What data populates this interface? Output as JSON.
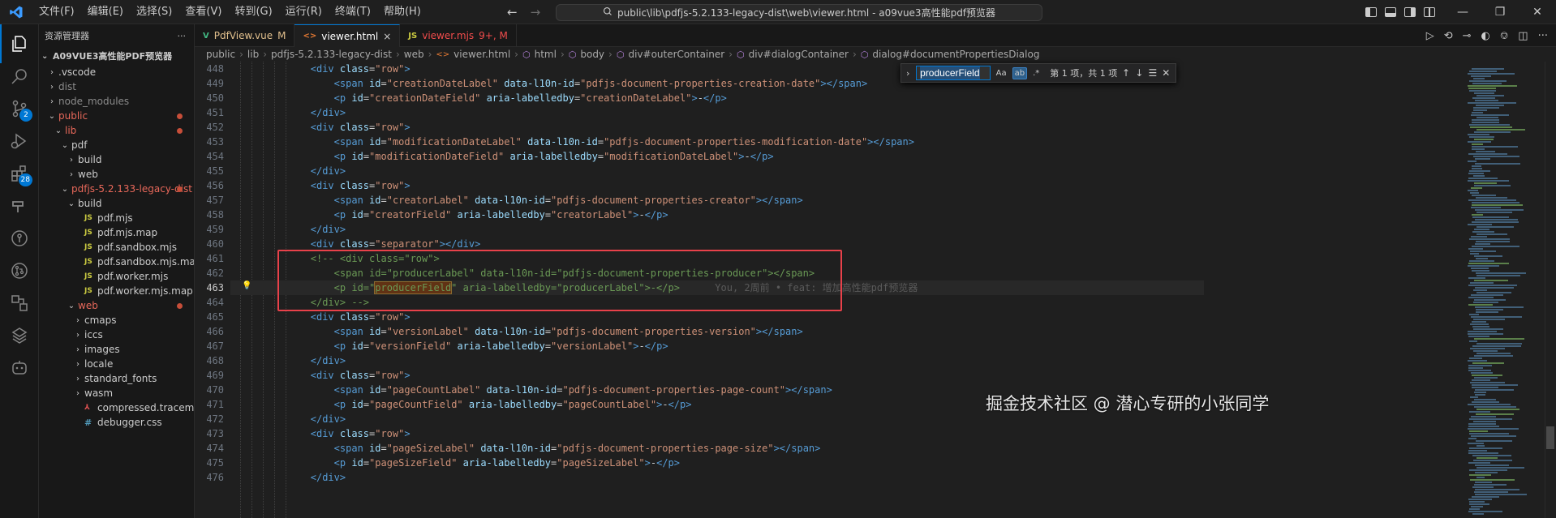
{
  "titlebar": {
    "menu": [
      "文件(F)",
      "编辑(E)",
      "选择(S)",
      "查看(V)",
      "转到(G)",
      "运行(R)",
      "终端(T)",
      "帮助(H)"
    ],
    "command_center": "public\\lib\\pdfjs-5.2.133-legacy-dist\\web\\viewer.html - a09vue3高性能pdf预览器"
  },
  "activity": {
    "scm_badge": "2",
    "extensions_badge": "28"
  },
  "sidebar": {
    "title": "资源管理器",
    "more": "···",
    "root": "A09VUE3高性能PDF预览器",
    "items": [
      {
        "label": ".vscode",
        "depth": 0,
        "kind": "folder-closed",
        "style": "normal"
      },
      {
        "label": "dist",
        "depth": 0,
        "kind": "folder-closed",
        "style": "dim"
      },
      {
        "label": "node_modules",
        "depth": 0,
        "kind": "folder-closed",
        "style": "dim"
      },
      {
        "label": "public",
        "depth": 0,
        "kind": "folder-open",
        "style": "red",
        "dot": true
      },
      {
        "label": "lib",
        "depth": 1,
        "kind": "folder-open",
        "style": "red",
        "dot": true
      },
      {
        "label": "pdf",
        "depth": 2,
        "kind": "folder-open",
        "style": "normal"
      },
      {
        "label": "build",
        "depth": 3,
        "kind": "folder-closed",
        "style": "normal"
      },
      {
        "label": "web",
        "depth": 3,
        "kind": "folder-closed",
        "style": "normal"
      },
      {
        "label": "pdfjs-5.2.133-legacy-dist",
        "depth": 2,
        "kind": "folder-open",
        "style": "red",
        "dot": true
      },
      {
        "label": "build",
        "depth": 3,
        "kind": "folder-open",
        "style": "normal"
      },
      {
        "label": "pdf.mjs",
        "depth": 4,
        "kind": "js",
        "style": "normal"
      },
      {
        "label": "pdf.mjs.map",
        "depth": 4,
        "kind": "js",
        "style": "normal"
      },
      {
        "label": "pdf.sandbox.mjs",
        "depth": 4,
        "kind": "js",
        "style": "normal"
      },
      {
        "label": "pdf.sandbox.mjs.map",
        "depth": 4,
        "kind": "js",
        "style": "normal"
      },
      {
        "label": "pdf.worker.mjs",
        "depth": 4,
        "kind": "js",
        "style": "normal"
      },
      {
        "label": "pdf.worker.mjs.map",
        "depth": 4,
        "kind": "js",
        "style": "normal"
      },
      {
        "label": "web",
        "depth": 3,
        "kind": "folder-open",
        "style": "red",
        "dot": true
      },
      {
        "label": "cmaps",
        "depth": 4,
        "kind": "folder-closed",
        "style": "normal"
      },
      {
        "label": "iccs",
        "depth": 4,
        "kind": "folder-closed",
        "style": "normal"
      },
      {
        "label": "images",
        "depth": 4,
        "kind": "folder-closed",
        "style": "normal"
      },
      {
        "label": "locale",
        "depth": 4,
        "kind": "folder-closed",
        "style": "normal"
      },
      {
        "label": "standard_fonts",
        "depth": 4,
        "kind": "folder-closed",
        "style": "normal"
      },
      {
        "label": "wasm",
        "depth": 4,
        "kind": "folder-closed",
        "style": "normal"
      },
      {
        "label": "compressed.tracemonkey-pld...",
        "depth": 4,
        "kind": "pdf",
        "style": "normal"
      },
      {
        "label": "debugger.css",
        "depth": 4,
        "kind": "css",
        "style": "normal"
      }
    ]
  },
  "tabs": [
    {
      "label": "PdfView.vue",
      "icon": "V",
      "status": "M",
      "active": false,
      "icon_color": "#42b883",
      "status_kind": "mod"
    },
    {
      "label": "viewer.html",
      "icon": "<>",
      "status": "×",
      "active": true,
      "icon_color": "#e37933",
      "status_kind": "close"
    },
    {
      "label": "viewer.mjs",
      "icon": "JS",
      "status": "9+, M",
      "active": false,
      "icon_color": "#cbcb41",
      "status_kind": "err"
    }
  ],
  "breadcrumbs": [
    "public",
    "lib",
    "pdfjs-5.2.133-legacy-dist",
    "web",
    "viewer.html",
    "html",
    "body",
    "div#outerContainer",
    "div#dialogContainer",
    "dialog#documentPropertiesDialog"
  ],
  "find": {
    "query": "producerField",
    "count": "第 1 项，共 1 项",
    "case_label": "Aa",
    "word_label": "ab",
    "regex_label": ".*"
  },
  "editor": {
    "current_line": 463,
    "blame": "You, 2周前 • feat: 增加高性能pdf预览器",
    "lines": [
      {
        "n": 448,
        "indent": 3,
        "tokens": [
          [
            "tag",
            "<div "
          ],
          [
            "attr",
            "class"
          ],
          [
            "txt",
            "="
          ],
          [
            "str",
            "\"row\""
          ],
          [
            "tag",
            ">"
          ]
        ]
      },
      {
        "n": 449,
        "indent": 4,
        "tokens": [
          [
            "tag",
            "<span "
          ],
          [
            "attr",
            "id"
          ],
          [
            "txt",
            "="
          ],
          [
            "str",
            "\"creationDateLabel\""
          ],
          [
            "txt",
            " "
          ],
          [
            "attr",
            "data-l10n-id"
          ],
          [
            "txt",
            "="
          ],
          [
            "str",
            "\"pdfjs-document-properties-creation-date\""
          ],
          [
            "tag",
            "></span>"
          ]
        ]
      },
      {
        "n": 450,
        "indent": 4,
        "tokens": [
          [
            "tag",
            "<p "
          ],
          [
            "attr",
            "id"
          ],
          [
            "txt",
            "="
          ],
          [
            "str",
            "\"creationDateField\""
          ],
          [
            "txt",
            " "
          ],
          [
            "attr",
            "aria-labelledby"
          ],
          [
            "txt",
            "="
          ],
          [
            "str",
            "\"creationDateLabel\""
          ],
          [
            "tag",
            ">"
          ],
          [
            "txt",
            "-"
          ],
          [
            "tag",
            "</p>"
          ]
        ]
      },
      {
        "n": 451,
        "indent": 3,
        "tokens": [
          [
            "tag",
            "</div>"
          ]
        ]
      },
      {
        "n": 452,
        "indent": 3,
        "tokens": [
          [
            "tag",
            "<div "
          ],
          [
            "attr",
            "class"
          ],
          [
            "txt",
            "="
          ],
          [
            "str",
            "\"row\""
          ],
          [
            "tag",
            ">"
          ]
        ]
      },
      {
        "n": 453,
        "indent": 4,
        "tokens": [
          [
            "tag",
            "<span "
          ],
          [
            "attr",
            "id"
          ],
          [
            "txt",
            "="
          ],
          [
            "str",
            "\"modificationDateLabel\""
          ],
          [
            "txt",
            " "
          ],
          [
            "attr",
            "data-l10n-id"
          ],
          [
            "txt",
            "="
          ],
          [
            "str",
            "\"pdfjs-document-properties-modification-date\""
          ],
          [
            "tag",
            "></span>"
          ]
        ]
      },
      {
        "n": 454,
        "indent": 4,
        "tokens": [
          [
            "tag",
            "<p "
          ],
          [
            "attr",
            "id"
          ],
          [
            "txt",
            "="
          ],
          [
            "str",
            "\"modificationDateField\""
          ],
          [
            "txt",
            " "
          ],
          [
            "attr",
            "aria-labelledby"
          ],
          [
            "txt",
            "="
          ],
          [
            "str",
            "\"modificationDateLabel\""
          ],
          [
            "tag",
            ">"
          ],
          [
            "txt",
            "-"
          ],
          [
            "tag",
            "</p>"
          ]
        ]
      },
      {
        "n": 455,
        "indent": 3,
        "tokens": [
          [
            "tag",
            "</div>"
          ]
        ]
      },
      {
        "n": 456,
        "indent": 3,
        "tokens": [
          [
            "tag",
            "<div "
          ],
          [
            "attr",
            "class"
          ],
          [
            "txt",
            "="
          ],
          [
            "str",
            "\"row\""
          ],
          [
            "tag",
            ">"
          ]
        ]
      },
      {
        "n": 457,
        "indent": 4,
        "tokens": [
          [
            "tag",
            "<span "
          ],
          [
            "attr",
            "id"
          ],
          [
            "txt",
            "="
          ],
          [
            "str",
            "\"creatorLabel\""
          ],
          [
            "txt",
            " "
          ],
          [
            "attr",
            "data-l10n-id"
          ],
          [
            "txt",
            "="
          ],
          [
            "str",
            "\"pdfjs-document-properties-creator\""
          ],
          [
            "tag",
            "></span>"
          ]
        ]
      },
      {
        "n": 458,
        "indent": 4,
        "tokens": [
          [
            "tag",
            "<p "
          ],
          [
            "attr",
            "id"
          ],
          [
            "txt",
            "="
          ],
          [
            "str",
            "\"creatorField\""
          ],
          [
            "txt",
            " "
          ],
          [
            "attr",
            "aria-labelledby"
          ],
          [
            "txt",
            "="
          ],
          [
            "str",
            "\"creatorLabel\""
          ],
          [
            "tag",
            ">"
          ],
          [
            "txt",
            "-"
          ],
          [
            "tag",
            "</p>"
          ]
        ]
      },
      {
        "n": 459,
        "indent": 3,
        "tokens": [
          [
            "tag",
            "</div>"
          ]
        ]
      },
      {
        "n": 460,
        "indent": 3,
        "tokens": [
          [
            "tag",
            "<div "
          ],
          [
            "attr",
            "class"
          ],
          [
            "txt",
            "="
          ],
          [
            "str",
            "\"separator\""
          ],
          [
            "tag",
            "></div>"
          ]
        ]
      },
      {
        "n": 461,
        "indent": 3,
        "tokens": [
          [
            "com",
            "<!-- <div class=\"row\">"
          ]
        ]
      },
      {
        "n": 462,
        "indent": 4,
        "tokens": [
          [
            "com",
            "<span id=\"producerLabel\" data-l10n-id=\"pdfjs-document-properties-producer\"></span>"
          ]
        ]
      },
      {
        "n": 463,
        "indent": 4,
        "tokens": [
          [
            "com",
            "<p id=\""
          ],
          [
            "match",
            "producerField"
          ],
          [
            "com",
            "\" aria-labelledby=\"producerLabel\">-</p>"
          ]
        ]
      },
      {
        "n": 464,
        "indent": 3,
        "tokens": [
          [
            "com",
            "</div> -->"
          ]
        ]
      },
      {
        "n": 465,
        "indent": 3,
        "tokens": [
          [
            "tag",
            "<div "
          ],
          [
            "attr",
            "class"
          ],
          [
            "txt",
            "="
          ],
          [
            "str",
            "\"row\""
          ],
          [
            "tag",
            ">"
          ]
        ]
      },
      {
        "n": 466,
        "indent": 4,
        "tokens": [
          [
            "tag",
            "<span "
          ],
          [
            "attr",
            "id"
          ],
          [
            "txt",
            "="
          ],
          [
            "str",
            "\"versionLabel\""
          ],
          [
            "txt",
            " "
          ],
          [
            "attr",
            "data-l10n-id"
          ],
          [
            "txt",
            "="
          ],
          [
            "str",
            "\"pdfjs-document-properties-version\""
          ],
          [
            "tag",
            "></span>"
          ]
        ]
      },
      {
        "n": 467,
        "indent": 4,
        "tokens": [
          [
            "tag",
            "<p "
          ],
          [
            "attr",
            "id"
          ],
          [
            "txt",
            "="
          ],
          [
            "str",
            "\"versionField\""
          ],
          [
            "txt",
            " "
          ],
          [
            "attr",
            "aria-labelledby"
          ],
          [
            "txt",
            "="
          ],
          [
            "str",
            "\"versionLabel\""
          ],
          [
            "tag",
            ">"
          ],
          [
            "txt",
            "-"
          ],
          [
            "tag",
            "</p>"
          ]
        ]
      },
      {
        "n": 468,
        "indent": 3,
        "tokens": [
          [
            "tag",
            "</div>"
          ]
        ]
      },
      {
        "n": 469,
        "indent": 3,
        "tokens": [
          [
            "tag",
            "<div "
          ],
          [
            "attr",
            "class"
          ],
          [
            "txt",
            "="
          ],
          [
            "str",
            "\"row\""
          ],
          [
            "tag",
            ">"
          ]
        ]
      },
      {
        "n": 470,
        "indent": 4,
        "tokens": [
          [
            "tag",
            "<span "
          ],
          [
            "attr",
            "id"
          ],
          [
            "txt",
            "="
          ],
          [
            "str",
            "\"pageCountLabel\""
          ],
          [
            "txt",
            " "
          ],
          [
            "attr",
            "data-l10n-id"
          ],
          [
            "txt",
            "="
          ],
          [
            "str",
            "\"pdfjs-document-properties-page-count\""
          ],
          [
            "tag",
            "></span>"
          ]
        ]
      },
      {
        "n": 471,
        "indent": 4,
        "tokens": [
          [
            "tag",
            "<p "
          ],
          [
            "attr",
            "id"
          ],
          [
            "txt",
            "="
          ],
          [
            "str",
            "\"pageCountField\""
          ],
          [
            "txt",
            " "
          ],
          [
            "attr",
            "aria-labelledby"
          ],
          [
            "txt",
            "="
          ],
          [
            "str",
            "\"pageCountLabel\""
          ],
          [
            "tag",
            ">"
          ],
          [
            "txt",
            "-"
          ],
          [
            "tag",
            "</p>"
          ]
        ]
      },
      {
        "n": 472,
        "indent": 3,
        "tokens": [
          [
            "tag",
            "</div>"
          ]
        ]
      },
      {
        "n": 473,
        "indent": 3,
        "tokens": [
          [
            "tag",
            "<div "
          ],
          [
            "attr",
            "class"
          ],
          [
            "txt",
            "="
          ],
          [
            "str",
            "\"row\""
          ],
          [
            "tag",
            ">"
          ]
        ]
      },
      {
        "n": 474,
        "indent": 4,
        "tokens": [
          [
            "tag",
            "<span "
          ],
          [
            "attr",
            "id"
          ],
          [
            "txt",
            "="
          ],
          [
            "str",
            "\"pageSizeLabel\""
          ],
          [
            "txt",
            " "
          ],
          [
            "attr",
            "data-l10n-id"
          ],
          [
            "txt",
            "="
          ],
          [
            "str",
            "\"pdfjs-document-properties-page-size\""
          ],
          [
            "tag",
            "></span>"
          ]
        ]
      },
      {
        "n": 475,
        "indent": 4,
        "tokens": [
          [
            "tag",
            "<p "
          ],
          [
            "attr",
            "id"
          ],
          [
            "txt",
            "="
          ],
          [
            "str",
            "\"pageSizeField\""
          ],
          [
            "txt",
            " "
          ],
          [
            "attr",
            "aria-labelledby"
          ],
          [
            "txt",
            "="
          ],
          [
            "str",
            "\"pageSizeLabel\""
          ],
          [
            "tag",
            ">"
          ],
          [
            "txt",
            "-"
          ],
          [
            "tag",
            "</p>"
          ]
        ]
      },
      {
        "n": 476,
        "indent": 3,
        "tokens": [
          [
            "tag",
            "</div>"
          ]
        ]
      }
    ]
  },
  "watermark": "掘金技术社区 @ 潜心专研的小张同学",
  "colors": {
    "accent": "#0078d4",
    "highlight_box": "#e8414a",
    "modified": "#e2c08d",
    "error": "#f14c4c"
  }
}
